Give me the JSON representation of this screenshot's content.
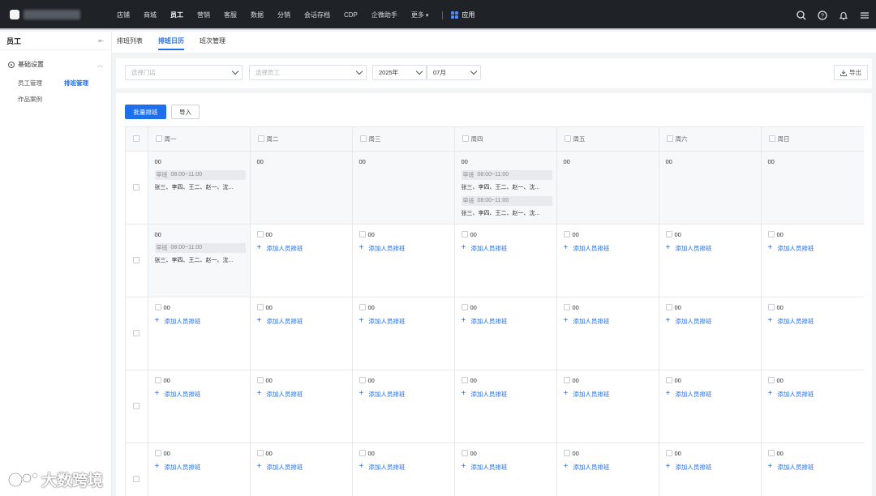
{
  "nav": {
    "items": [
      "店铺",
      "商城",
      "员工",
      "营销",
      "客服",
      "数据",
      "分销",
      "会话存档",
      "CDP",
      "企微助手",
      "更多"
    ],
    "active": "员工",
    "more_arrow": "▾",
    "app_label": "应用"
  },
  "top_icons": [
    "search-icon",
    "help-icon",
    "bell-icon",
    "menu-icon"
  ],
  "sidebar": {
    "title": "员工",
    "collapse_icon": "⇤",
    "group": {
      "label": "基础设置",
      "icon": "gear-icon"
    },
    "items": [
      "员工管理",
      "排班管理",
      "作品案例"
    ],
    "active_item": "排班管理"
  },
  "tabs": [
    "排班列表",
    "排班日历",
    "班次管理"
  ],
  "active_tab": "排班日历",
  "filters": {
    "store_placeholder": "选择门店",
    "staff_placeholder": "选择员工",
    "year": "2025年",
    "month": "07月",
    "export_label": "导出"
  },
  "buttons": {
    "batch": "批量排班",
    "import": "导入"
  },
  "weekdays": [
    "周一",
    "周二",
    "周三",
    "周四",
    "周五",
    "周六",
    "周日"
  ],
  "cell_day": "00",
  "add_label": "添加人员排班",
  "shift": {
    "name": "早班",
    "time": "08:00~11:00",
    "staff": "张三、李四、王二、赵一、沈..."
  },
  "rows": [
    [
      {
        "shifts": 1
      },
      {
        "shifts": 0
      },
      {
        "shifts": 0
      },
      {
        "shifts": 2
      },
      {
        "shifts": 0
      },
      {
        "shifts": 0
      },
      {
        "shifts": 0
      }
    ],
    [
      {
        "shifts": 1
      },
      {
        "add": true
      },
      {
        "add": true
      },
      {
        "add": true
      },
      {
        "add": true
      },
      {
        "add": true
      },
      {
        "add": true
      }
    ],
    [
      {
        "add": true
      },
      {
        "add": true
      },
      {
        "add": true
      },
      {
        "add": true
      },
      {
        "add": true
      },
      {
        "add": true
      },
      {
        "add": true
      }
    ],
    [
      {
        "add": true
      },
      {
        "add": true
      },
      {
        "add": true
      },
      {
        "add": true
      },
      {
        "add": true
      },
      {
        "add": true
      },
      {
        "add": true
      }
    ],
    [
      {
        "add": true
      },
      {
        "add": true
      },
      {
        "add": true
      },
      {
        "add": true
      },
      {
        "add": true
      },
      {
        "add": true
      },
      {
        "add": true
      }
    ]
  ],
  "colors": {
    "primary": "#1f6feb",
    "topbar": "#1f2227"
  },
  "watermark": "大数跨境"
}
